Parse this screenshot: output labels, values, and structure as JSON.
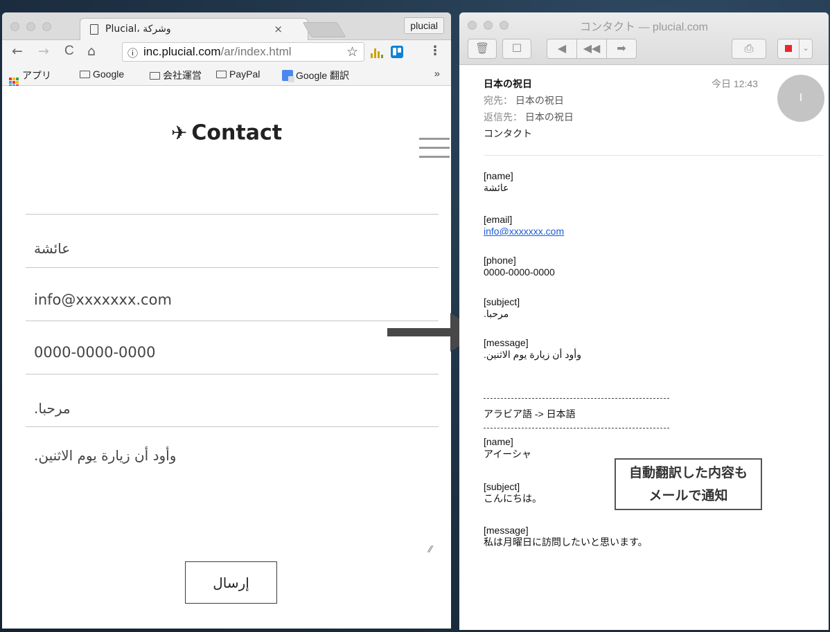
{
  "browser": {
    "tab_title": "Plucial، وشركة",
    "tab_close": "×",
    "profile_label": "plucial",
    "url_host": "inc.plucial.com",
    "url_path": "/ar/index.html",
    "bookmarks": [
      "アプリ",
      "Google",
      "会社運営",
      "PayPal",
      "Google 翻訳"
    ],
    "bookmarks_more": "»",
    "nav": {
      "back": "←",
      "forward": "→",
      "reload": "C",
      "home": "⌂",
      "info": "ⓘ",
      "star": "☆",
      "menu": "⋮"
    }
  },
  "contact_page": {
    "title": "Contact",
    "plane_icon": "paper-plane-icon",
    "fields": {
      "name": "عائشة",
      "email": "info@xxxxxxx.com",
      "phone": "0000-0000-0000",
      "subject": ".مرحبا",
      "message": ".وأود أن زيارة يوم الاثنين"
    },
    "submit_label": "إرسال",
    "resize_glyph": "⁄⁄"
  },
  "mail": {
    "window_title": "コンタクト — plucial.com",
    "sender": "日本の祝日",
    "time": "今日 12:43",
    "to_label": "宛先：",
    "to_value": "日本の祝日",
    "reply_label": "返信先：",
    "reply_value": "日本の祝日",
    "subject": "コンタクト",
    "avatar_initial": "I",
    "body": {
      "name_label": "[name]",
      "name_value": "عائشة",
      "email_label": "[email]",
      "email_value": "info@xxxxxxx.com",
      "phone_label": "[phone]",
      "phone_value": "0000-0000-0000",
      "subject_label": "[subject]",
      "subject_value": ".مرحبا",
      "message_label": "[message]",
      "message_value": ".وأود أن زيارة يوم الاثنين",
      "translation_header": "アラビア語 -> 日本語",
      "tr_name_label": "[name]",
      "tr_name_value": "アイーシャ",
      "tr_subject_label": "[subject]",
      "tr_subject_value": "こんにちは。",
      "tr_message_label": "[message]",
      "tr_message_value": "私は月曜日に訪問したいと思います。"
    }
  },
  "annotation": {
    "line1": "自動翻訳した内容も",
    "line2": "メールで通知"
  },
  "colors": {
    "link": "#1a5bd6",
    "flag": "#e8262a",
    "arrow": "#484848",
    "trello": "#0a83d9"
  }
}
